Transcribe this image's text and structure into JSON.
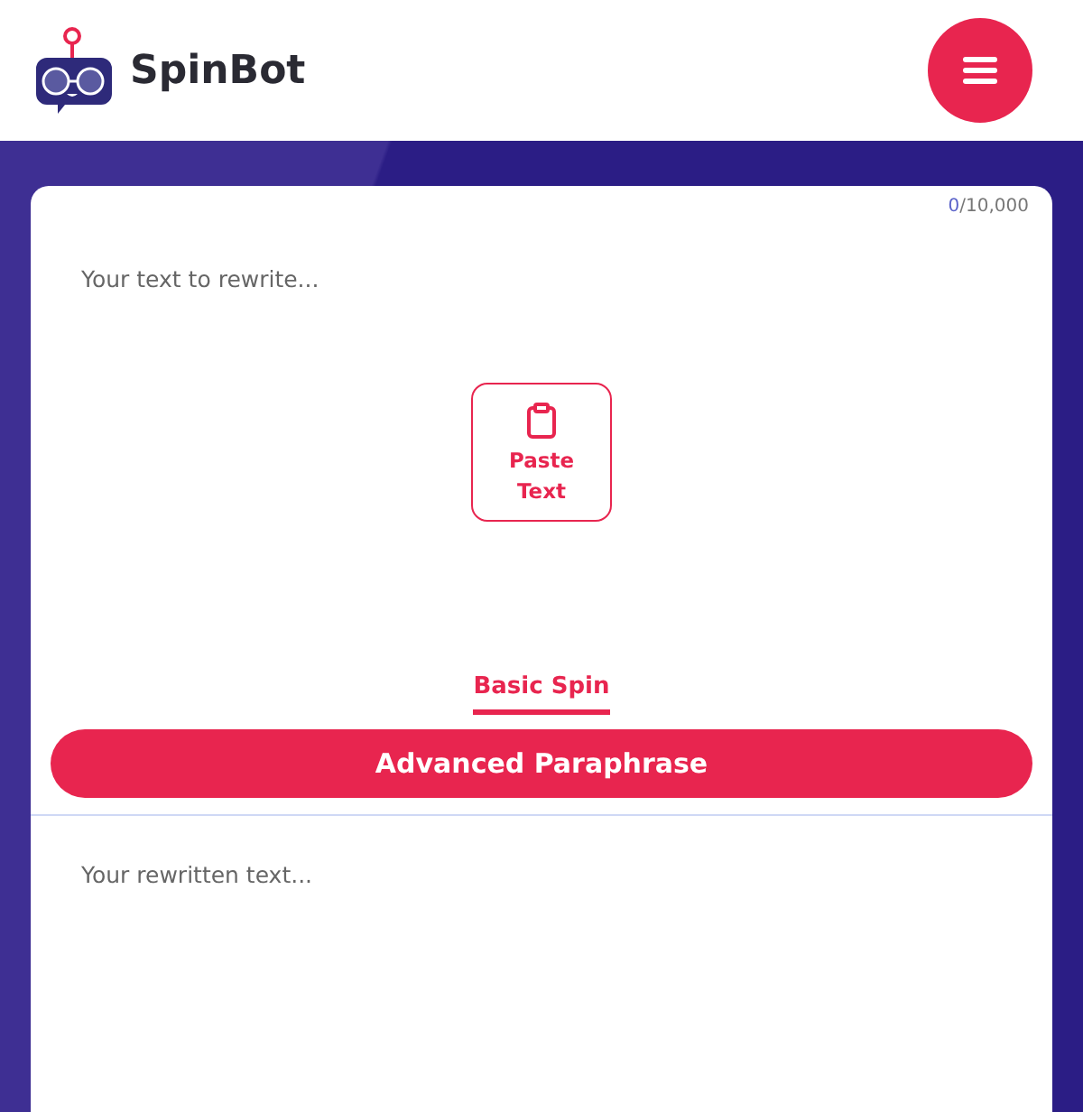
{
  "header": {
    "brand": "SpinBot"
  },
  "editor": {
    "counter": {
      "count": "0",
      "limit": "/10,000"
    },
    "input": {
      "placeholder": "Your text to rewrite..."
    },
    "paste_button": "Paste Text"
  },
  "mode_tab": {
    "label": "Basic Spin",
    "selected": true
  },
  "advanced_button": "Advanced Paraphrase",
  "output": {
    "placeholder": "Your rewritten text..."
  }
}
